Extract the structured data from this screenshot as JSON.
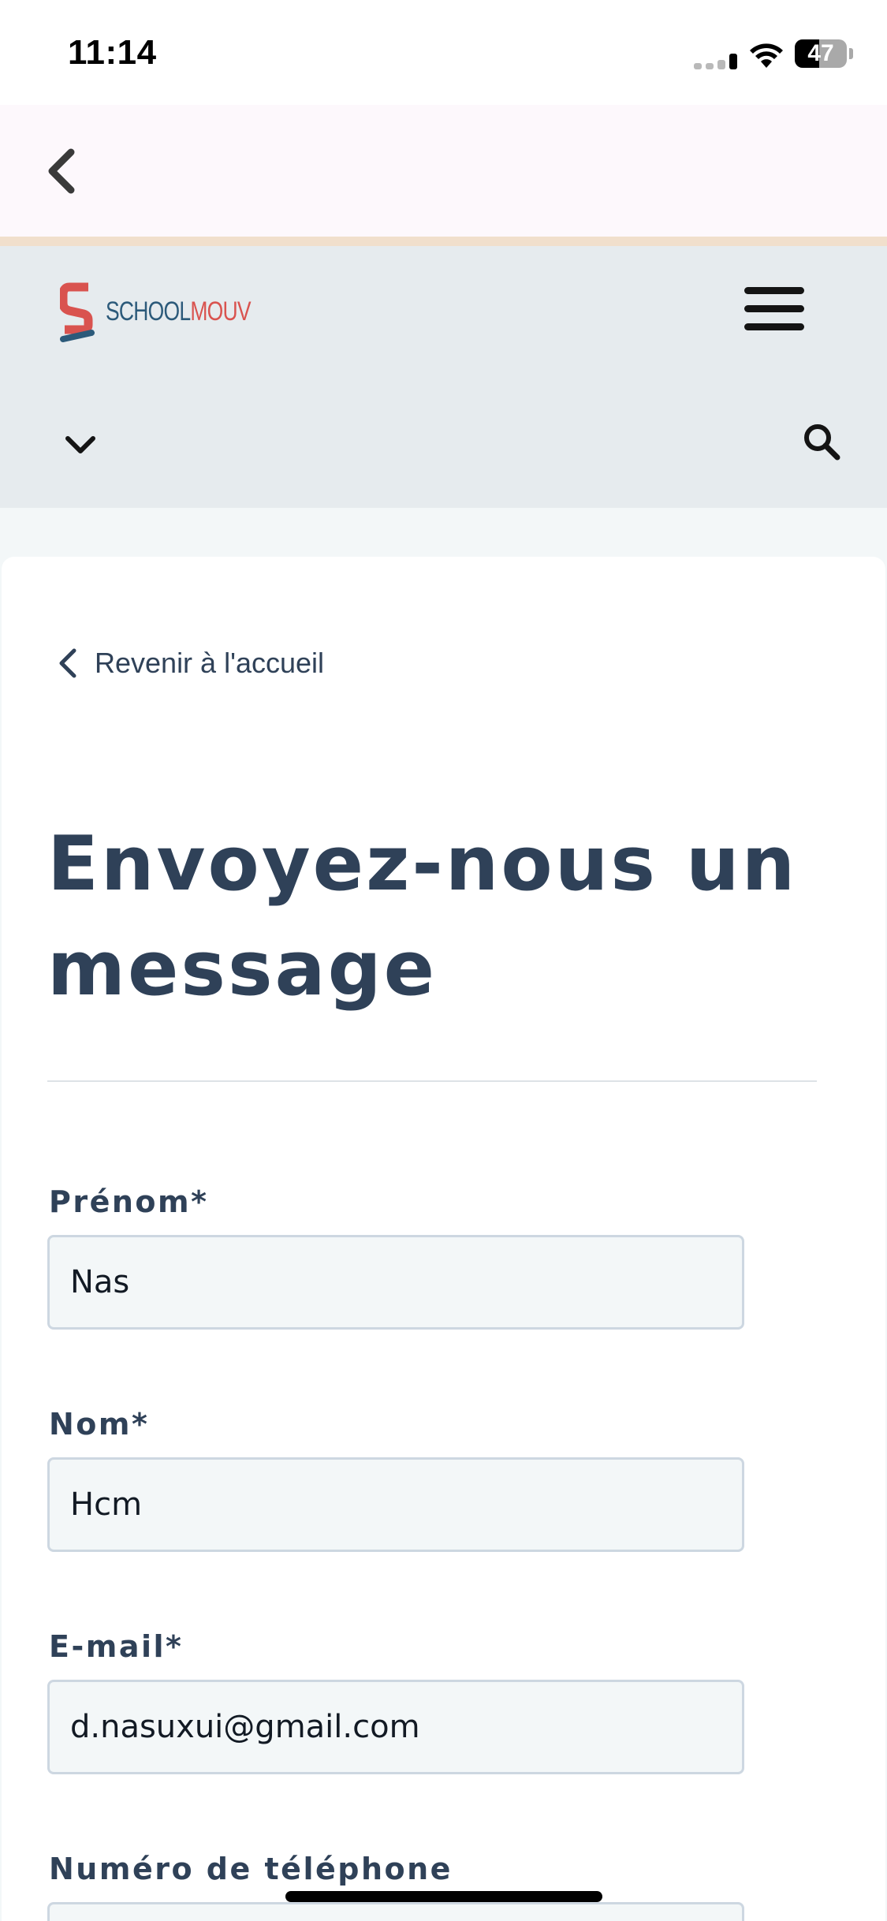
{
  "status_bar": {
    "time": "11:14",
    "battery_level": "47"
  },
  "header": {
    "logo_part1": "SCHOOL",
    "logo_part2": "MOUV"
  },
  "main": {
    "back_link": "Revenir à l'accueil",
    "title_line1": "Envoyez-nous un",
    "title_line2": "message"
  },
  "form": {
    "fields": [
      {
        "label": "Prénom*",
        "value": "Nas"
      },
      {
        "label": "Nom*",
        "value": "Hcm"
      },
      {
        "label": "E-mail*",
        "value": "d.nasuxui@gmail.com"
      },
      {
        "label": "Numéro de téléphone",
        "value": ""
      }
    ]
  },
  "colors": {
    "title": "#2f4158",
    "header_bg": "#e6ebee",
    "nav_bg": "#fdf8fc",
    "input_bg": "#f3f7f8",
    "brand_red": "#d9534f",
    "brand_blue": "#2c5a7a"
  },
  "icons": {
    "nav_back": "chevron-left-icon",
    "menu": "hamburger-menu-icon",
    "dropdown": "chevron-down-icon",
    "search": "search-icon",
    "back_link": "chevron-left-icon"
  }
}
